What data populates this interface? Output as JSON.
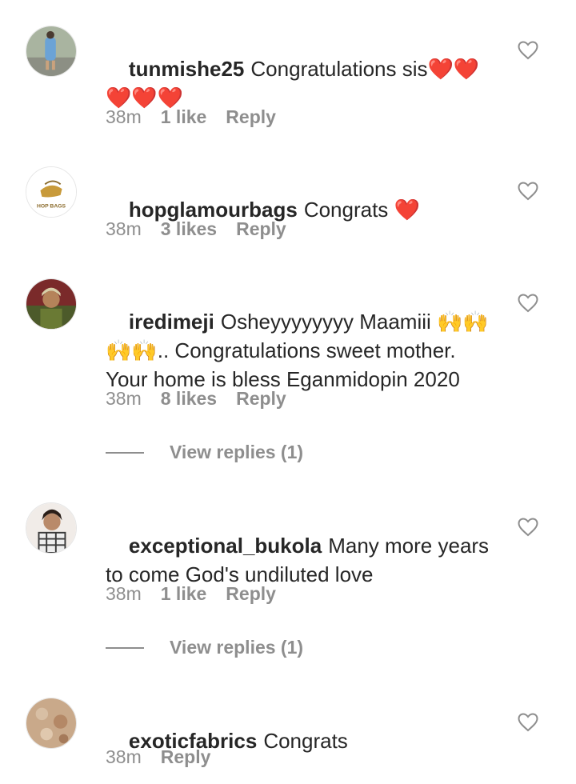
{
  "comments": [
    {
      "username": "tunmishe25",
      "text": "Congratulations sis❤️❤️\n❤️❤️❤️",
      "time": "38m",
      "likes": "1 like",
      "reply": "Reply"
    },
    {
      "username": "hopglamourbags",
      "text": "Congrats ❤️",
      "time": "38m",
      "likes": "3 likes",
      "reply": "Reply",
      "avatar_text": "HOP BAGS"
    },
    {
      "username": "iredimeji",
      "text": "Osheyyyyyyyy Maamiii 🙌🙌\n🙌🙌.. Congratulations sweet mother.\nYour home is bless Eganmidopin 2020",
      "time": "38m",
      "likes": "8 likes",
      "reply": "Reply",
      "view_replies": "View replies (1)"
    },
    {
      "username": "exceptional_bukola",
      "text": "Many more years\nto come God's undiluted love",
      "time": "38m",
      "likes": "1 like",
      "reply": "Reply",
      "view_replies": "View replies (1)"
    },
    {
      "username": "exoticfabrics",
      "text": "Congrats",
      "time": "38m",
      "reply": "Reply"
    }
  ],
  "icons": {
    "like": "heart-outline-icon"
  },
  "colors": {
    "text": "#262626",
    "secondary": "#8e8e8e",
    "heart_emoji": "#e0151a"
  }
}
